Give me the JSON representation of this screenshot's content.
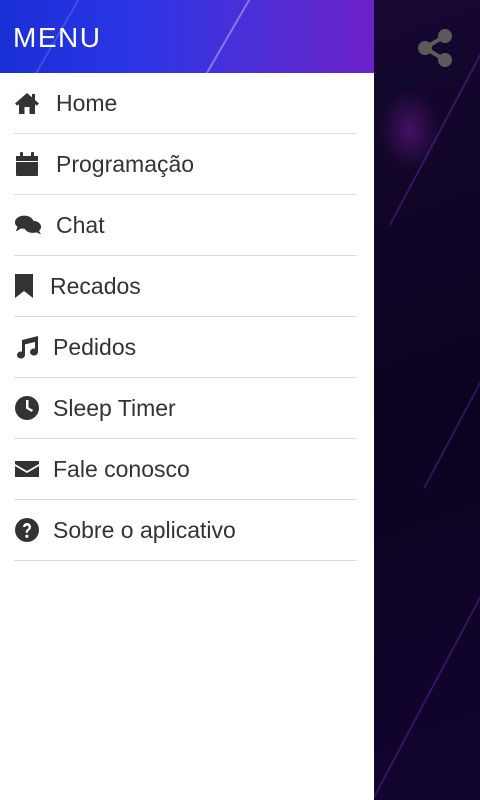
{
  "drawer": {
    "title": "MENU",
    "items": [
      {
        "label": "Home",
        "icon": "home-icon"
      },
      {
        "label": "Programação",
        "icon": "calendar-icon"
      },
      {
        "label": "Chat",
        "icon": "chat-icon"
      },
      {
        "label": "Recados",
        "icon": "bookmark-icon"
      },
      {
        "label": "Pedidos",
        "icon": "music-note-icon"
      },
      {
        "label": "Sleep Timer",
        "icon": "clock-icon"
      },
      {
        "label": "Fale conosco",
        "icon": "envelope-icon"
      },
      {
        "label": "Sobre o aplicativo",
        "icon": "question-circle-icon"
      }
    ]
  },
  "app": {
    "share_icon": "share-icon"
  },
  "colors": {
    "header_gradient_start": "#1b2fd6",
    "header_gradient_end": "#6d22c8",
    "text": "#333333",
    "divider": "#dcdcdc",
    "background": "#0b0414"
  }
}
